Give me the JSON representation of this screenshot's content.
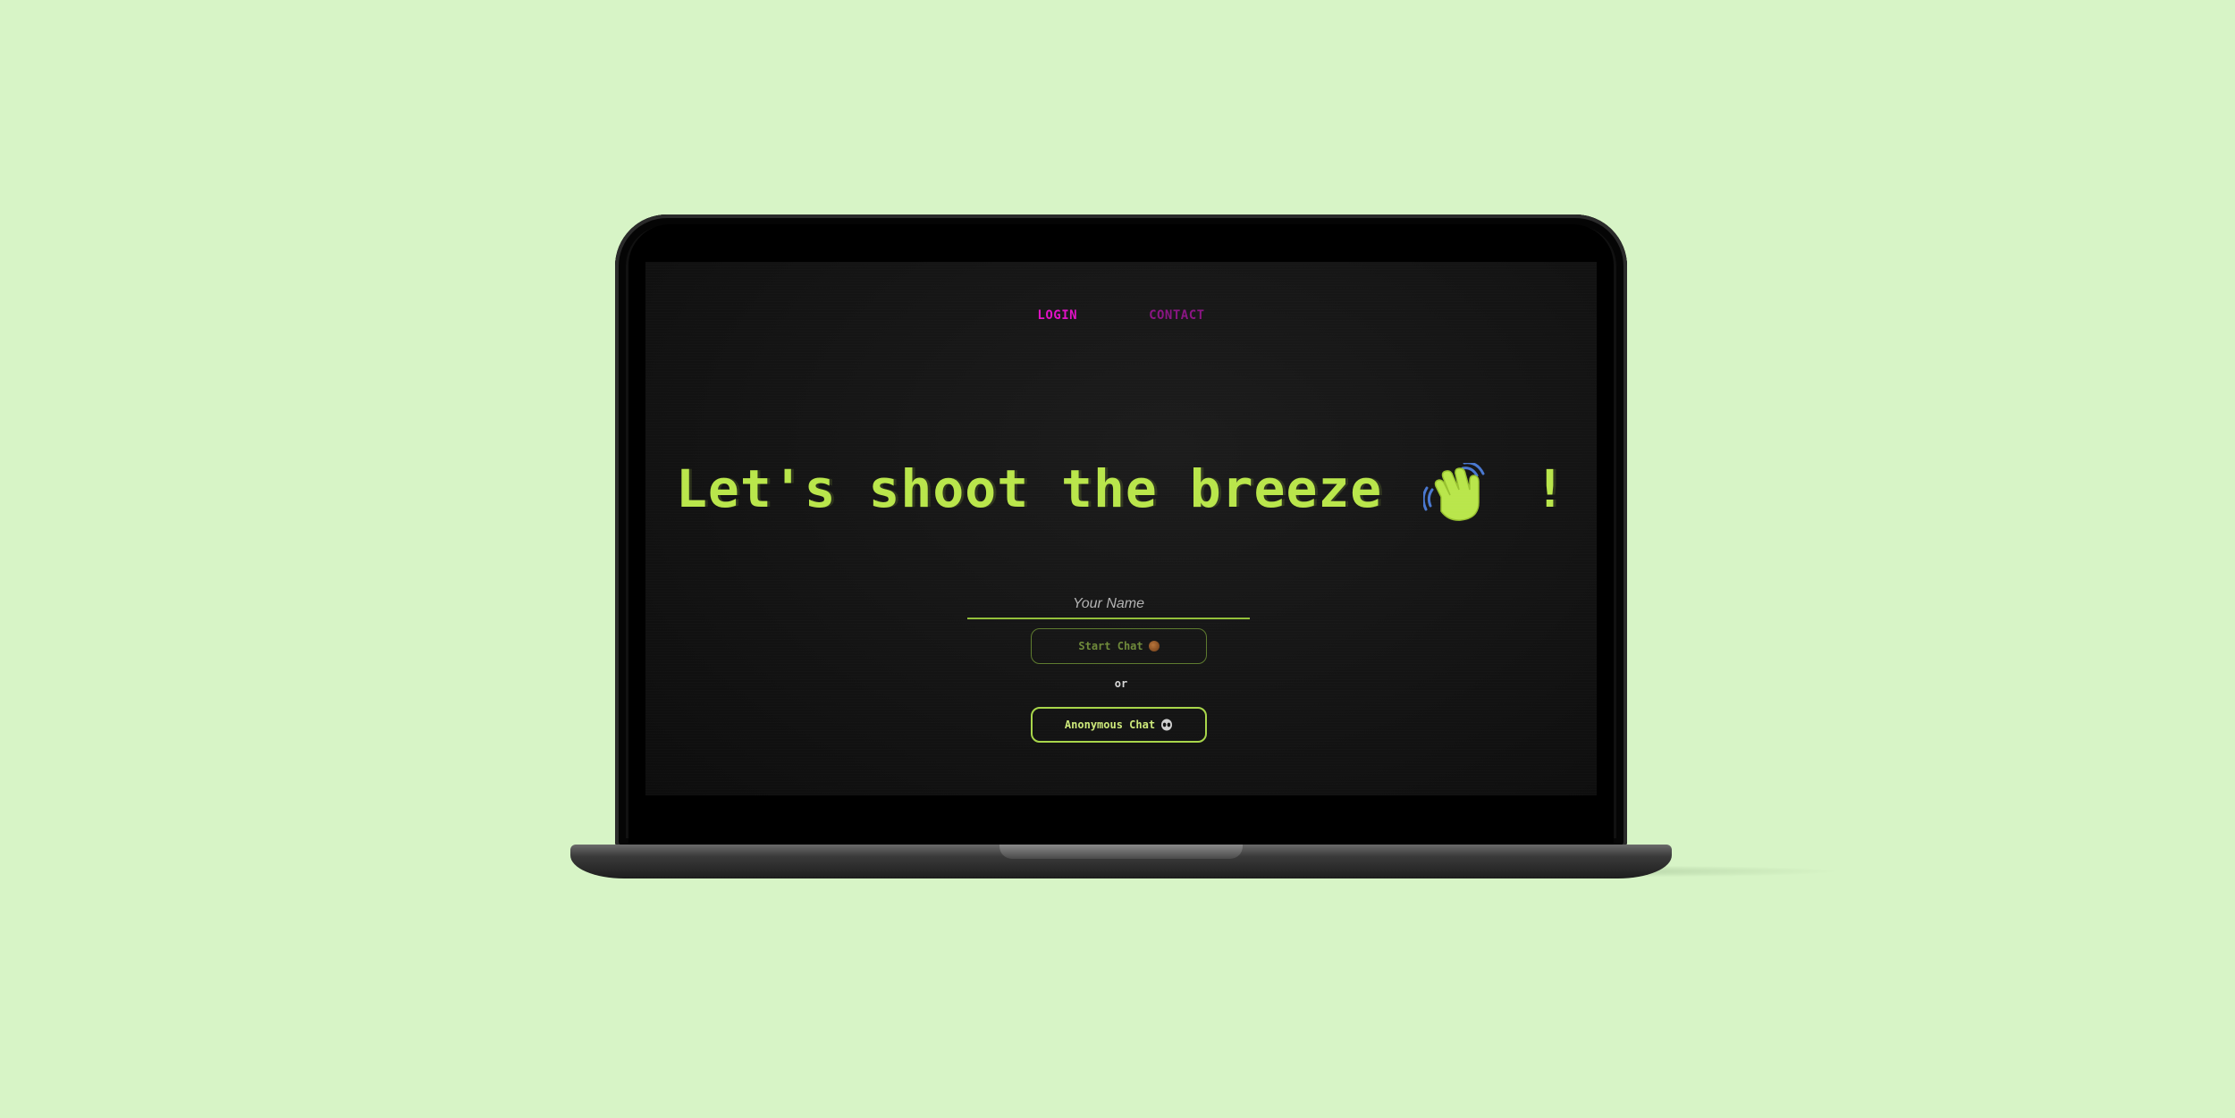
{
  "nav": {
    "items": [
      {
        "label": "LOGIN",
        "color": "#e011c4"
      },
      {
        "label": "CONTACT",
        "color": "#8a1583"
      }
    ]
  },
  "hero": {
    "headline": "Let's shoot the breeze",
    "icon": "waving-hand-icon",
    "suffix": "!"
  },
  "form": {
    "name_placeholder": "Your Name",
    "name_value": "",
    "start_button": "Start Chat",
    "start_icon": "emoji-face-icon",
    "separator": "or",
    "anon_button": "Anonymous Chat",
    "anon_icon": "alien-icon"
  },
  "colors": {
    "accent_green": "#b9e64b",
    "accent_magenta": "#e011c4",
    "page_background": "#d7f4c6",
    "screen_background": "#141414"
  }
}
